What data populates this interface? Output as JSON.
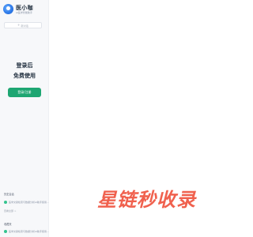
{
  "brand": {
    "name": "医小咖",
    "subtitle": "AI医学智能助手"
  },
  "sidebar": {
    "new_chat_label": "新对话",
    "login_prompt_line1": "登录后",
    "login_prompt_line2": "免费使用",
    "login_button": "登录/注册"
  },
  "history": {
    "title": "历史会话",
    "items": [
      {
        "text": "医学文献检索与数据分析AI助手使用..."
      }
    ],
    "more": "查看全部 >"
  },
  "favorites": {
    "title": "收藏夹",
    "items": [
      {
        "text": "医学文献检索与数据分析AI助手使用..."
      }
    ]
  },
  "watermark": {
    "text": "星链秒收录"
  },
  "colors": {
    "accent": "#1ea672",
    "watermark": "#f0614e"
  }
}
